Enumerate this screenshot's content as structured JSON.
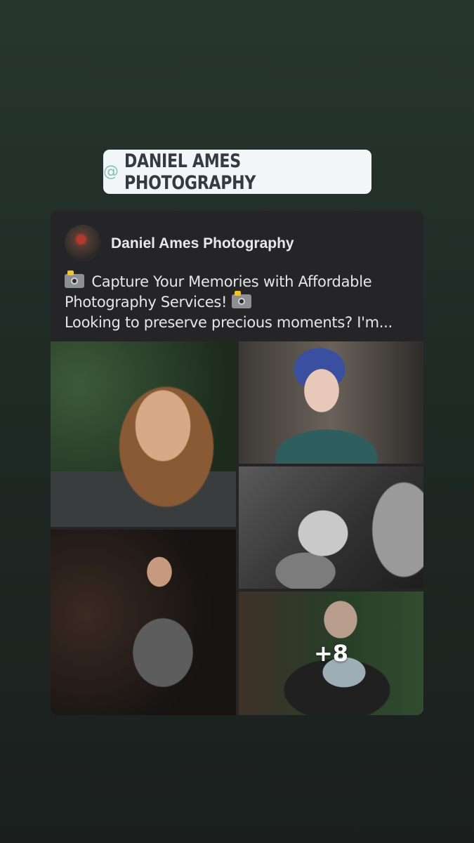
{
  "mention": {
    "at_symbol": "@",
    "label": "DANIEL AMES PHOTOGRAPHY"
  },
  "post": {
    "author": "Daniel Ames Photography",
    "text_line1": "Capture Your Memories with Affordable",
    "text_line2": "Photography Services!",
    "text_line3": "Looking to preserve precious moments? I'm...",
    "icon": "camera-flash-icon",
    "photos": [
      "portrait of bearded man with glasses",
      "woman with blue hair and glasses",
      "black and white baby on shoulder",
      "pregnant woman in grey dress",
      "woman holding baby"
    ],
    "more_count": "+8"
  },
  "colors": {
    "background_top": "#27362f",
    "card": "#252527",
    "mention_bg": "#f3f6f8",
    "mention_at": "#7fc5ae"
  }
}
